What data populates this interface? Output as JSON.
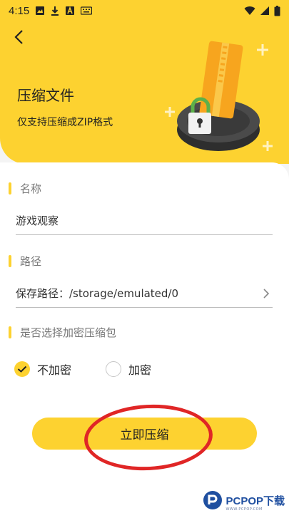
{
  "status_bar": {
    "time": "4:15"
  },
  "header": {
    "title": "压缩文件",
    "subtitle": "仅支持压缩成ZIP格式"
  },
  "form": {
    "name_label": "名称",
    "name_value": "游戏观察",
    "path_label": "路径",
    "path_value": "保存路径：/storage/emulated/0",
    "encrypt_label": "是否选择加密压缩包",
    "options": [
      {
        "label": "不加密",
        "selected": true
      },
      {
        "label": "加密",
        "selected": false
      }
    ]
  },
  "actions": {
    "compress_label": "立即压缩"
  },
  "watermark": {
    "text": "PCPOP下载",
    "sub": "WWW.PCPOP.COM"
  },
  "colors": {
    "accent": "#FDD230",
    "annotation": "#e02626"
  }
}
